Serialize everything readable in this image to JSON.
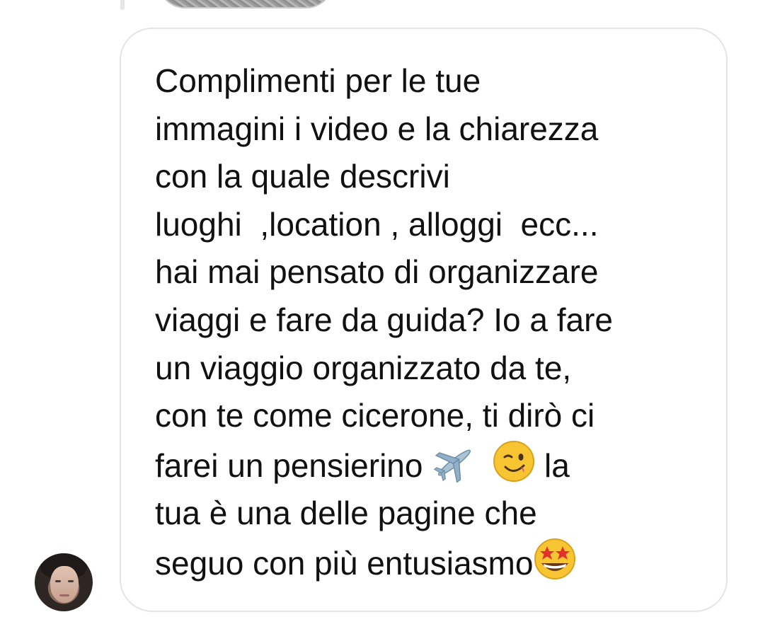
{
  "conversation": {
    "message": {
      "lines": [
        "Complimenti per le tue",
        "immagini i video e la chiarezza",
        "con la quale descrivi",
        "luoghi  ,location , alloggi  ecc...",
        "hai mai pensato di organizzare",
        "viaggi e fare da guida? Io a fare",
        "un viaggio organizzato da te,",
        "con te come cicerone, ti dirò ci",
        "farei un pensierino ",
        "tua è una delle pagine che",
        "seguo con più entusiasmo"
      ],
      "line9_tail": " la",
      "emojis": [
        "airplane-icon",
        "winking-face-icon",
        "star-struck-face-icon"
      ]
    },
    "colors": {
      "bubble_border": "#e4e4e4",
      "text": "#111111",
      "emoji_yellow": "#f7c531",
      "airplane": "#9bb7cc"
    }
  }
}
